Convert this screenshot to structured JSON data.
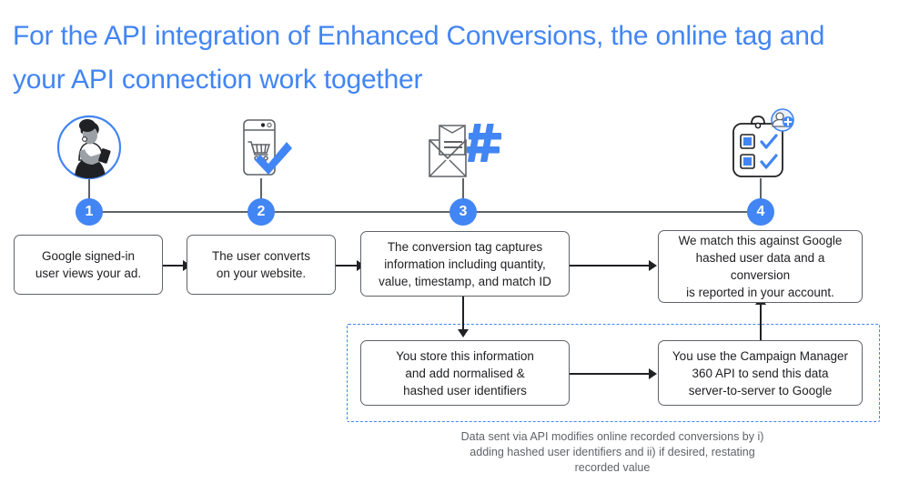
{
  "title": "For the API integration of Enhanced Conversions, the online tag and your API connection work together",
  "colors": {
    "brand_blue": "#4285F4",
    "line_gray": "#5f6368",
    "text_dark": "#202124",
    "caption_gray": "#5f6368"
  },
  "timeline": {
    "steps": [
      {
        "number": "1",
        "icon": "person-using-phone-icon"
      },
      {
        "number": "2",
        "icon": "mobile-cart-checkmark-icon"
      },
      {
        "number": "3",
        "icon": "envelope-hash-icon"
      },
      {
        "number": "4",
        "icon": "clipboard-checklist-add-user-icon"
      }
    ]
  },
  "flow": {
    "nodes": [
      {
        "id": "node-1",
        "name": "box-google-signed-in-user",
        "lines": [
          "Google signed-in",
          "user views your ad."
        ]
      },
      {
        "id": "node-2",
        "name": "box-user-converts",
        "lines": [
          "The user converts",
          "on your website."
        ]
      },
      {
        "id": "node-3",
        "name": "box-conversion-tag-captures",
        "lines": [
          "The conversion tag captures",
          "information including quantity,",
          "value, timestamp, and match ID"
        ]
      },
      {
        "id": "node-4",
        "name": "box-google-match-conversion",
        "lines": [
          "We match this against Google",
          "hashed user data and a",
          "conversion",
          "is reported in your account."
        ]
      },
      {
        "id": "node-5",
        "name": "box-store-and-hash-identifiers",
        "lines": [
          "You store this information",
          "and add normalised &",
          "hashed user identifiers"
        ]
      },
      {
        "id": "node-6",
        "name": "box-campaign-manager-360-api",
        "lines": [
          "You use the Campaign Manager",
          "360 API to send this data",
          "server-to-server to Google"
        ]
      }
    ]
  },
  "caption": {
    "lines": [
      "Data sent via API modifies online recorded conversions by i)",
      "adding hashed user identifiers and ii) if desired, restating",
      "recorded value"
    ]
  }
}
